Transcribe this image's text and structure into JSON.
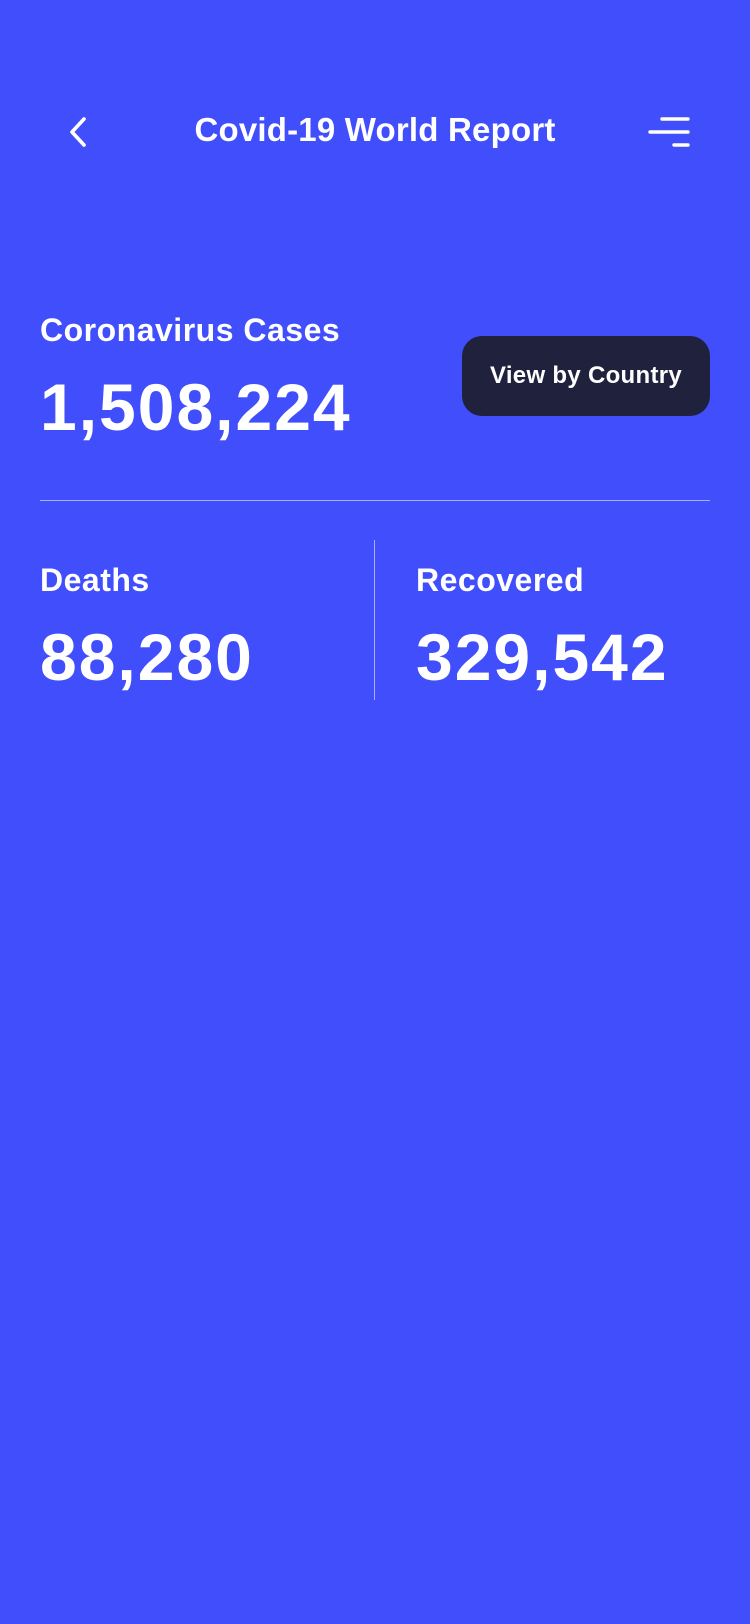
{
  "header": {
    "title": "Covid-19 World Report",
    "back_icon": "chevron-left-icon",
    "menu_icon": "menu-icon"
  },
  "cases": {
    "label": "Coronavirus Cases",
    "value": "1,508,224"
  },
  "actions": {
    "view_by_country": "View by Country"
  },
  "stats": {
    "deaths": {
      "label": "Deaths",
      "value": "88,280"
    },
    "recovered": {
      "label": "Recovered",
      "value": "329,542"
    }
  },
  "colors": {
    "background": "#414EFC",
    "button": "#1F213D",
    "text": "#FFFFFF"
  }
}
